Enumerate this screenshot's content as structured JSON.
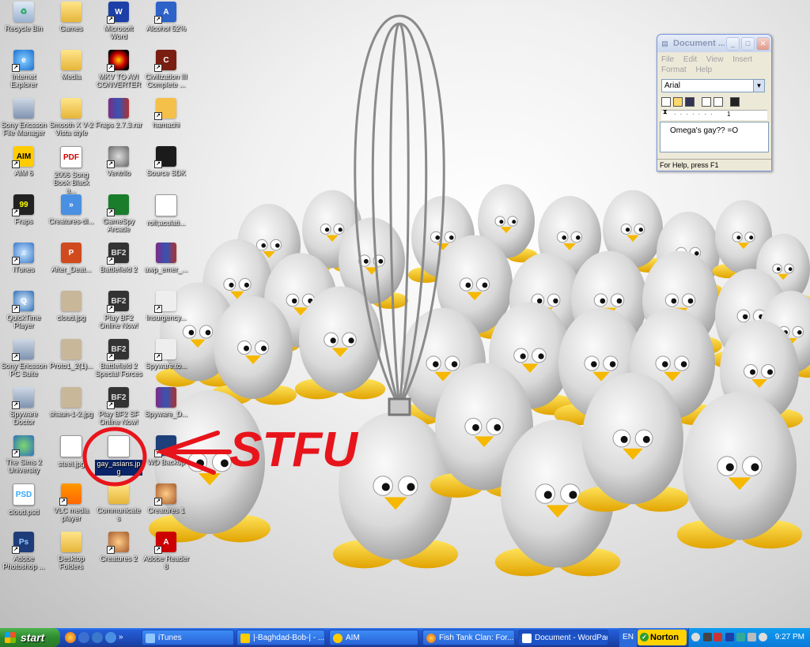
{
  "desktop": {
    "icons": [
      {
        "label": "Recycle Bin",
        "glyph": "♻"
      },
      {
        "label": "Games",
        "glyph": ""
      },
      {
        "label": "Microsoft Word",
        "glyph": "W"
      },
      {
        "label": "Alcohol 52%",
        "glyph": "A"
      },
      {
        "label": "Internet Explorer",
        "glyph": "e"
      },
      {
        "label": "Media",
        "glyph": ""
      },
      {
        "label": "MKV TO AVI CONVERTER",
        "glyph": ""
      },
      {
        "label": "Civilization III Complete ...",
        "glyph": "C"
      },
      {
        "label": "Sony Ericsson File Manager",
        "glyph": ""
      },
      {
        "label": "Smooth X V-2 Vista style",
        "glyph": ""
      },
      {
        "label": "Fraps 2.7.3.rar",
        "glyph": ""
      },
      {
        "label": "hamachi",
        "glyph": ""
      },
      {
        "label": "AIM 6",
        "glyph": "AIM"
      },
      {
        "label": "2006 Song Book Black a...",
        "glyph": "PDF"
      },
      {
        "label": "Ventrilo",
        "glyph": ""
      },
      {
        "label": "Source SDK",
        "glyph": ""
      },
      {
        "label": "Fraps",
        "glyph": "99"
      },
      {
        "label": "Creatures-dl...",
        "glyph": "»"
      },
      {
        "label": "GameSpy Arcade",
        "glyph": ""
      },
      {
        "label": "rofl;aculati...",
        "glyph": ""
      },
      {
        "label": "iTunes",
        "glyph": "♫"
      },
      {
        "label": "After_Deat...",
        "glyph": "P"
      },
      {
        "label": "Battlefield 2",
        "glyph": "BF2"
      },
      {
        "label": "awp_emer_...",
        "glyph": ""
      },
      {
        "label": "QuickTime Player",
        "glyph": "Q"
      },
      {
        "label": "cloud.jpg",
        "glyph": ""
      },
      {
        "label": "Play BF2 Online Now!",
        "glyph": "BF2"
      },
      {
        "label": "Insurgency...",
        "glyph": ""
      },
      {
        "label": "Sony Ericsson PC Suite",
        "glyph": ""
      },
      {
        "label": "Proto1_2(1)...",
        "glyph": ""
      },
      {
        "label": "Battlefield 2 Special Forces",
        "glyph": "BF2"
      },
      {
        "label": "Spyware.to...",
        "glyph": ""
      },
      {
        "label": "Spyware Doctor",
        "glyph": ""
      },
      {
        "label": "shaun-1-2.jpg",
        "glyph": ""
      },
      {
        "label": "Play BF2 SF Online Now!",
        "glyph": "BF2"
      },
      {
        "label": "Spyware_D...",
        "glyph": ""
      },
      {
        "label": "The Sims 2 University",
        "glyph": ""
      },
      {
        "label": "steel.jpg",
        "glyph": ""
      },
      {
        "label": "gay_asians.jpg",
        "glyph": ""
      },
      {
        "label": "WD Backup",
        "glyph": ""
      },
      {
        "label": "cloud.psd",
        "glyph": "PSD"
      },
      {
        "label": "VLC media player",
        "glyph": ""
      },
      {
        "label": "Communicates",
        "glyph": ""
      },
      {
        "label": "Creatures 1",
        "glyph": ""
      },
      {
        "label": "Adobe Photoshop ...",
        "glyph": "Ps"
      },
      {
        "label": "Desktop Folders",
        "glyph": ""
      },
      {
        "label": "Creatures 2",
        "glyph": ""
      },
      {
        "label": "Adobe Reader 8",
        "glyph": "A"
      }
    ],
    "annotation": "STFU"
  },
  "wordpad": {
    "title": "Document ...",
    "menu": [
      "File",
      "Edit",
      "View",
      "Insert",
      "Format",
      "Help"
    ],
    "font": "Arial",
    "content": "Omega's gay?? =O",
    "status": "For Help, press F1",
    "ruler_mark": "1"
  },
  "taskbar": {
    "start_label": "start",
    "tasks": [
      "iTunes",
      "|-Baghdad-Bob-| - ...",
      "AIM",
      "Fish Tank Clan: For...",
      "Document - WordPad"
    ],
    "language": "EN",
    "norton": "Norton",
    "clock": "9:27 PM"
  },
  "colors": {
    "annotation": "#e8141b",
    "taskbar": "#245edb",
    "start": "#2e8b2e",
    "norton": "#ffd200"
  }
}
